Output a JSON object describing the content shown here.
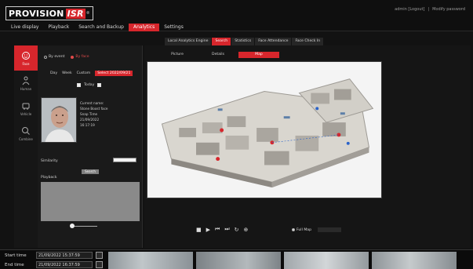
{
  "brand": {
    "logo_main": "PROVISION",
    "logo_suffix": "ISR",
    "logo_tm": "®"
  },
  "header": {
    "user": "admin [Logout]",
    "modify_password": "Modify password"
  },
  "main_menu": [
    {
      "label": "Live display"
    },
    {
      "label": "Playback"
    },
    {
      "label": "Search and Backup"
    },
    {
      "label": "Analytics"
    },
    {
      "label": "Settings"
    }
  ],
  "side_nav": [
    {
      "label": "Face"
    },
    {
      "label": "Human"
    },
    {
      "label": "Vehicle"
    },
    {
      "label": "Combine"
    }
  ],
  "sub_tabs": [
    {
      "label": "Local Analytics Engine"
    },
    {
      "label": "Search"
    },
    {
      "label": "Statistics"
    },
    {
      "label": "Face Attendance"
    },
    {
      "label": "Face Check In"
    }
  ],
  "left_panel": {
    "mode_options": [
      {
        "label": "By event"
      },
      {
        "label": "By face"
      }
    ],
    "period_options": [
      {
        "label": "Day"
      },
      {
        "label": "Week"
      },
      {
        "label": "Custom"
      }
    ],
    "selected_date": "Select 2022/09/21",
    "today_label": "Today",
    "face_info": {
      "current_name": "Current name:",
      "name_value": "Stone Boost face",
      "snap_time": "Snap Time",
      "date": "21/09/2022",
      "time": "16:17:19"
    },
    "similarity_label": "Similarity",
    "similarity_value": "",
    "search_button": "Search",
    "playback_label": "Playback"
  },
  "main_panel": {
    "view_tabs": [
      {
        "label": "Picture"
      },
      {
        "label": "Details"
      },
      {
        "label": "Map"
      }
    ],
    "full_map_label": "Full Map"
  },
  "bottom": {
    "start_label": "Start time",
    "start_value": "21/09/2022 15:37:59",
    "end_label": "End time",
    "end_value": "21/09/2022 16:37:59"
  },
  "colors": {
    "accent": "#d7262c",
    "background": "#121212"
  },
  "icons": {
    "face": "face-icon",
    "human": "human-icon",
    "vehicle": "vehicle-icon",
    "combine": "combine-icon",
    "calendar": "calendar-icon"
  }
}
